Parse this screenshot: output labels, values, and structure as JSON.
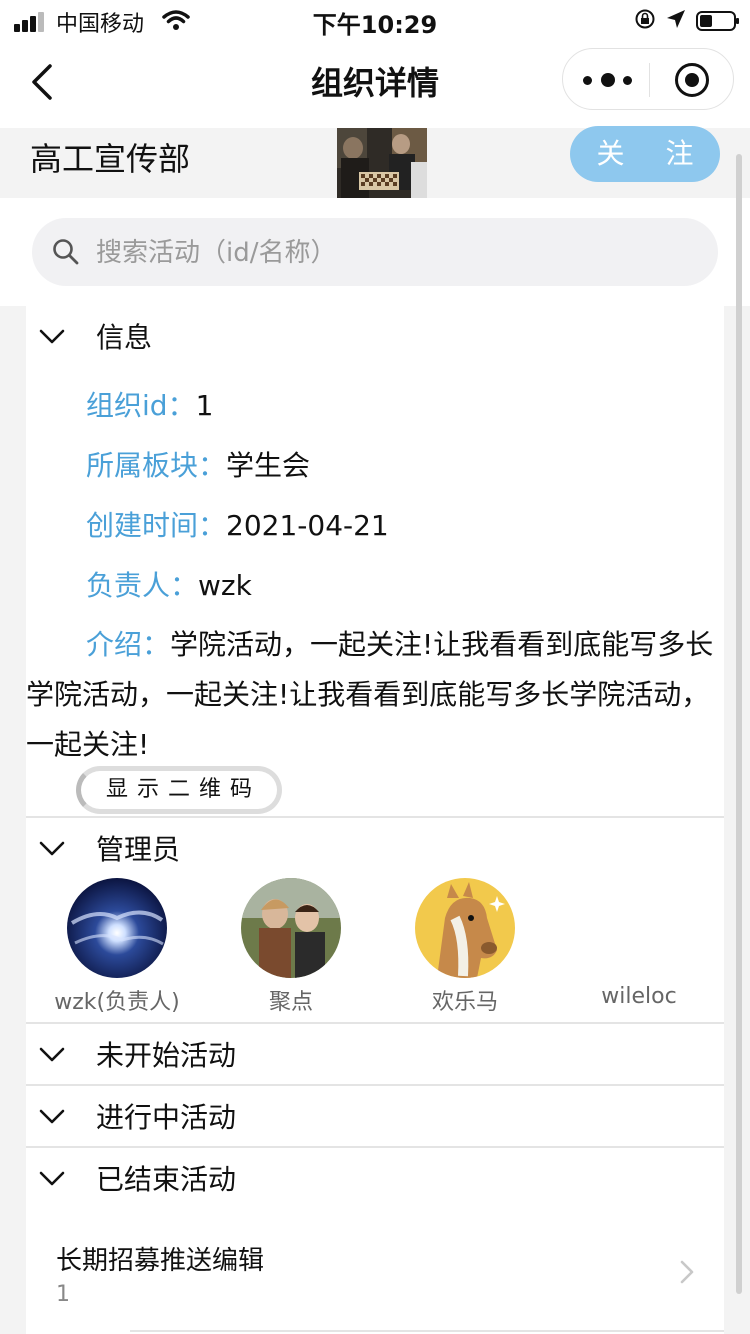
{
  "status_bar": {
    "carrier": "中国移动",
    "time": "下午10:29"
  },
  "nav": {
    "title": "组织详情"
  },
  "org": {
    "name": "高工宣传部",
    "follow_label": "关 注"
  },
  "search": {
    "placeholder": "搜索活动（id/名称）"
  },
  "info": {
    "title": "信息",
    "org_id_label": "组织id：",
    "org_id": "1",
    "board_label": "所属板块：",
    "board": "学生会",
    "created_label": "创建时间：",
    "created": "2021-04-21",
    "owner_label": "负责人：",
    "owner": "wzk",
    "intro_label": "介绍：",
    "intro": "学院活动，一起关注!让我看看到底能写多长学院活动，一起关注!让我看看到底能写多长学院活动，一起关注!",
    "qr_button": "显示二维码"
  },
  "admins": {
    "title": "管理员",
    "members": [
      {
        "name": "wzk(负责人)"
      },
      {
        "name": "聚点"
      },
      {
        "name": "欢乐马"
      },
      {
        "name": "wileloc"
      }
    ]
  },
  "sections": {
    "not_started": "未开始活动",
    "ongoing": "进行中活动",
    "ended": "已结束活动"
  },
  "ended_activities": [
    {
      "title": "长期招募推送编辑",
      "count": "1"
    }
  ],
  "colors": {
    "label_blue": "#4aa0d8",
    "follow_button": "#8ec8ee"
  }
}
